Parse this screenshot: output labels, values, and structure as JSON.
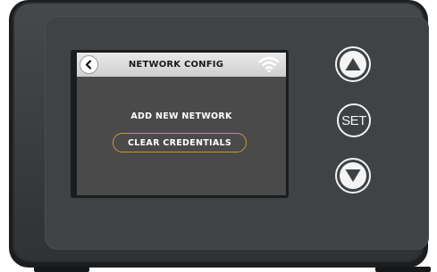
{
  "screen": {
    "title": "NETWORK CONFIG",
    "back_icon": "chevron-left-icon",
    "status_icon": "wifi-icon",
    "menu": {
      "add_network_label": "ADD NEW NETWORK",
      "clear_credentials_label": "CLEAR CREDENTIALS",
      "selected_item": "CLEAR CREDENTIALS"
    }
  },
  "hardware_buttons": {
    "up_icon": "triangle-up-icon",
    "set_label": "SET",
    "down_icon": "triangle-down-icon"
  },
  "colors": {
    "device_body": "#3b3f41",
    "screen_background": "#4a4a4a",
    "titlebar": "#dcdcdc",
    "selection_outline": "#c79a2e",
    "button_outline": "#f2f2f2"
  }
}
